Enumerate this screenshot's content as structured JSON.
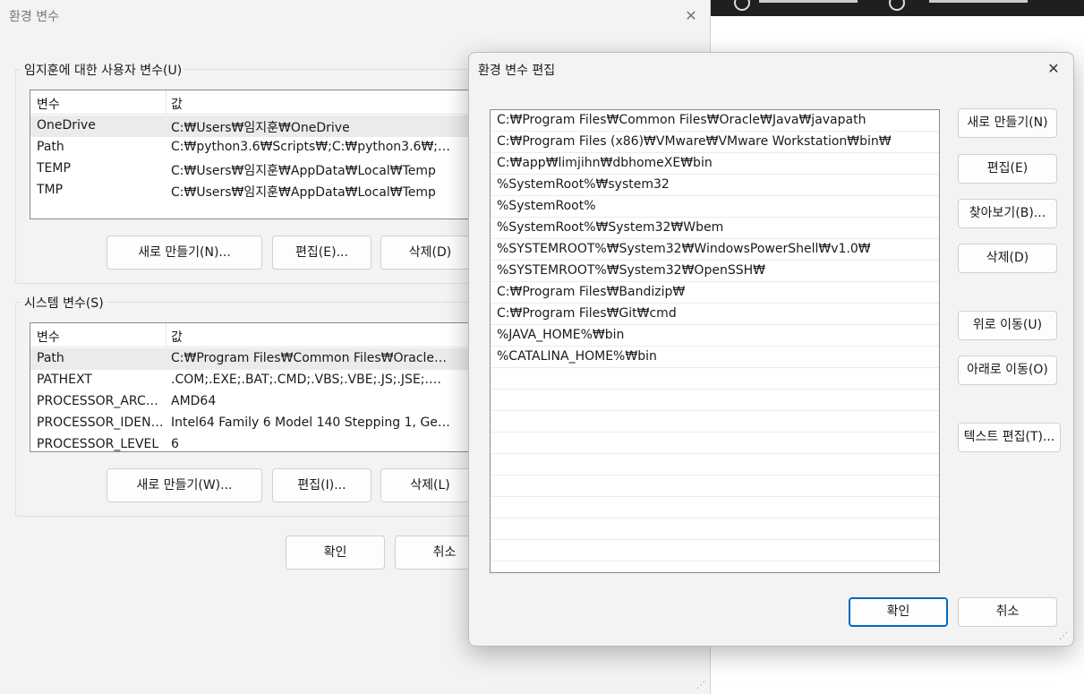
{
  "main_window": {
    "title": "환경 변수",
    "close_icon": "close-icon",
    "user_vars": {
      "group_label": "임지훈에 대한 사용자 변수(U)",
      "col_variable": "변수",
      "col_value": "값",
      "rows": [
        {
          "name": "OneDrive",
          "value": "C:₩Users₩임지훈₩OneDrive"
        },
        {
          "name": "Path",
          "value": "C:₩python3.6₩Scripts₩;C:₩python3.6₩;C:₩Us..."
        },
        {
          "name": "TEMP",
          "value": "C:₩Users₩임지훈₩AppData₩Local₩Temp"
        },
        {
          "name": "TMP",
          "value": "C:₩Users₩임지훈₩AppData₩Local₩Temp"
        }
      ],
      "btn_new": "새로 만들기(N)...",
      "btn_edit": "편집(E)...",
      "btn_delete": "삭제(D)"
    },
    "system_vars": {
      "group_label": "시스템 변수(S)",
      "col_variable": "변수",
      "col_value": "값",
      "rows": [
        {
          "name": "Path",
          "value": "C:₩Program Files₩Common Files₩Oracle₩Ja..."
        },
        {
          "name": "PATHEXT",
          "value": ".COM;.EXE;.BAT;.CMD;.VBS;.VBE;.JS;.JSE;.WSF;...."
        },
        {
          "name": "PROCESSOR_ARCH...",
          "value": "AMD64"
        },
        {
          "name": "PROCESSOR_IDENT...",
          "value": "Intel64 Family 6 Model 140 Stepping 1, Gen..."
        },
        {
          "name": "PROCESSOR_LEVEL",
          "value": "6"
        }
      ],
      "btn_new": "새로 만들기(W)...",
      "btn_edit": "편집(I)...",
      "btn_delete": "삭제(L)"
    },
    "btn_ok": "확인",
    "btn_cancel": "취소"
  },
  "edit_dialog": {
    "title": "환경 변수 편집",
    "close_icon": "close-icon",
    "paths": [
      "C:₩Program Files₩Common Files₩Oracle₩Java₩javapath",
      "C:₩Program Files (x86)₩VMware₩VMware Workstation₩bin₩",
      "C:₩app₩limjihn₩dbhomeXE₩bin",
      "%SystemRoot%₩system32",
      "%SystemRoot%",
      "%SystemRoot%₩System32₩Wbem",
      "%SYSTEMROOT%₩System32₩WindowsPowerShell₩v1.0₩",
      "%SYSTEMROOT%₩System32₩OpenSSH₩",
      "C:₩Program Files₩Bandizip₩",
      "C:₩Program Files₩Git₩cmd",
      "%JAVA_HOME%₩bin",
      "%CATALINA_HOME%₩bin"
    ],
    "empty_rows": 9,
    "btn_new": "새로 만들기(N)",
    "btn_edit": "편집(E)",
    "btn_browse": "찾아보기(B)...",
    "btn_delete": "삭제(D)",
    "btn_move_up": "위로 이동(U)",
    "btn_move_down": "아래로 이동(O)",
    "btn_edit_text": "텍스트 편집(T)...",
    "btn_ok": "확인",
    "btn_cancel": "취소"
  },
  "colors": {
    "window_bg": "#f3f3f3",
    "accent": "#0067c0",
    "selected_row": "#ebebeb"
  }
}
